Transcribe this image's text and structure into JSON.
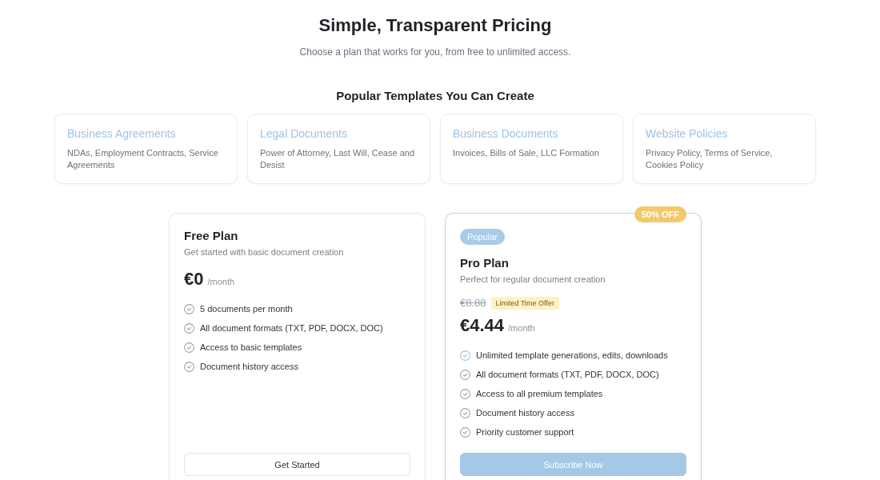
{
  "header": {
    "title": "Simple, Transparent Pricing",
    "subtitle": "Choose a plan that works for you, from free to unlimited access."
  },
  "templates": {
    "heading": "Popular Templates You Can Create",
    "items": [
      {
        "title": "Business Agreements",
        "description": "NDAs, Employment Contracts, Service Agreements"
      },
      {
        "title": "Legal Documents",
        "description": "Power of Attorney, Last Will, Cease and Desist"
      },
      {
        "title": "Business Documents",
        "description": "Invoices, Bills of Sale, LLC Formation"
      },
      {
        "title": "Website Policies",
        "description": "Privacy Policy, Terms of Service, Cookies Policy"
      }
    ]
  },
  "plans": [
    {
      "name": "Free Plan",
      "featured": false,
      "description": "Get started with basic document creation",
      "price": "€0",
      "period": "/month",
      "features": [
        {
          "text": "5 documents per month",
          "highlighted": false
        },
        {
          "text": "All document formats (TXT, PDF, DOCX, DOC)",
          "highlighted": false
        },
        {
          "text": "Access to basic templates",
          "highlighted": false
        },
        {
          "text": "Document history access",
          "highlighted": false
        }
      ],
      "button": {
        "label": "Get Started",
        "kind": "outline"
      }
    },
    {
      "name": "Pro Plan",
      "featured": true,
      "corner_badge": "50% OFF",
      "popular_badge": "Popular",
      "description": "Perfect for regular document creation",
      "original_price": "€8.88",
      "offer_badge": "Limited Time Offer",
      "price": "€4.44",
      "period": "/month",
      "features": [
        {
          "text": "Unlimited template generations, edits, downloads",
          "highlighted": true
        },
        {
          "text": "All document formats (TXT, PDF, DOCX, DOC)",
          "highlighted": false
        },
        {
          "text": "Access to all premium templates",
          "highlighted": false
        },
        {
          "text": "Document history access",
          "highlighted": false
        },
        {
          "text": "Priority customer support",
          "highlighted": false
        }
      ],
      "button": {
        "label": "Subscribe Now",
        "kind": "filled"
      }
    }
  ]
}
